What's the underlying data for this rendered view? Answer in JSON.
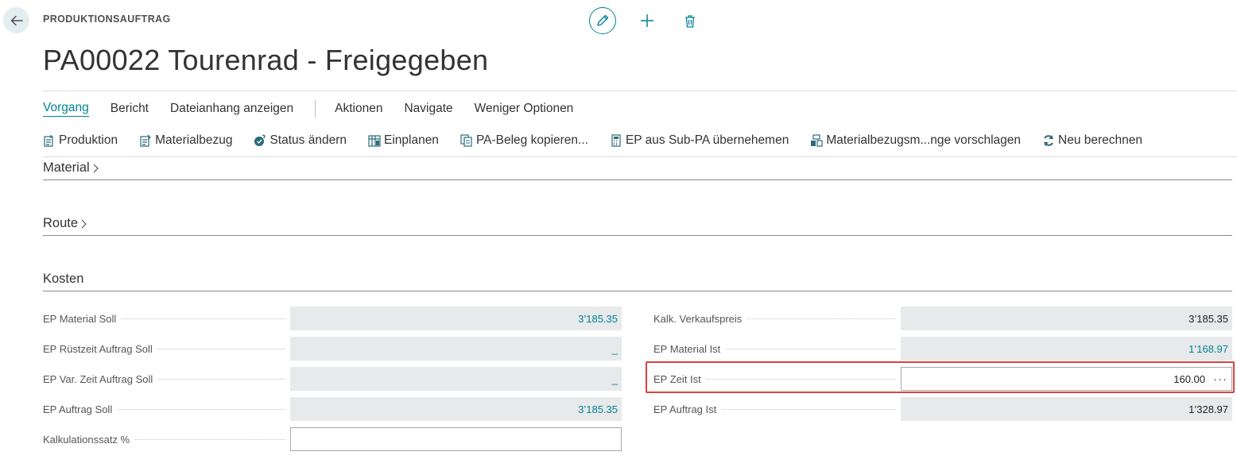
{
  "header": {
    "caption": "PRODUKTIONSAUFTRAG",
    "title": "PA00022 Tourenrad - Freigegeben"
  },
  "menu": {
    "items": [
      "Vorgang",
      "Bericht",
      "Dateianhang anzeigen"
    ],
    "items2": [
      "Aktionen",
      "Navigate",
      "Weniger Optionen"
    ]
  },
  "actions": [
    {
      "label": "Produktion",
      "icon": "production-icon"
    },
    {
      "label": "Materialbezug",
      "icon": "material-issue-icon"
    },
    {
      "label": "Status ändern",
      "icon": "status-change-icon"
    },
    {
      "label": "Einplanen",
      "icon": "plan-icon"
    },
    {
      "label": "PA-Beleg kopieren...",
      "icon": "copy-document-icon"
    },
    {
      "label": "EP aus Sub-PA übernehemen",
      "icon": "calculator-icon"
    },
    {
      "label": "Materialbezugsm...nge vorschlagen",
      "icon": "suggest-quantity-icon"
    },
    {
      "label": "Neu berechnen",
      "icon": "refresh-icon"
    }
  ],
  "sections": {
    "material": "Material",
    "route": "Route",
    "kosten": "Kosten"
  },
  "kosten": {
    "left": [
      {
        "label": "EP Material Soll",
        "value": "3’185.35"
      },
      {
        "label": "EP Rüstzeit Auftrag Soll",
        "value": "_"
      },
      {
        "label": "EP Var. Zeit Auftrag Soll",
        "value": "_"
      },
      {
        "label": "EP Auftrag Soll",
        "value": "3’185.35"
      },
      {
        "label": "Kalkulationssatz %",
        "value": ""
      }
    ],
    "right": [
      {
        "label": "Kalk. Verkaufspreis",
        "value": "3’185.35"
      },
      {
        "label": "EP Material Ist",
        "value": "1’168.97"
      },
      {
        "label": "EP Zeit Ist",
        "value": "160.00",
        "more": "···"
      },
      {
        "label": "EP Auftrag Ist",
        "value": "1’328.97"
      }
    ]
  },
  "colors": {
    "accent": "#00849a",
    "highlight": "#d9453d"
  }
}
